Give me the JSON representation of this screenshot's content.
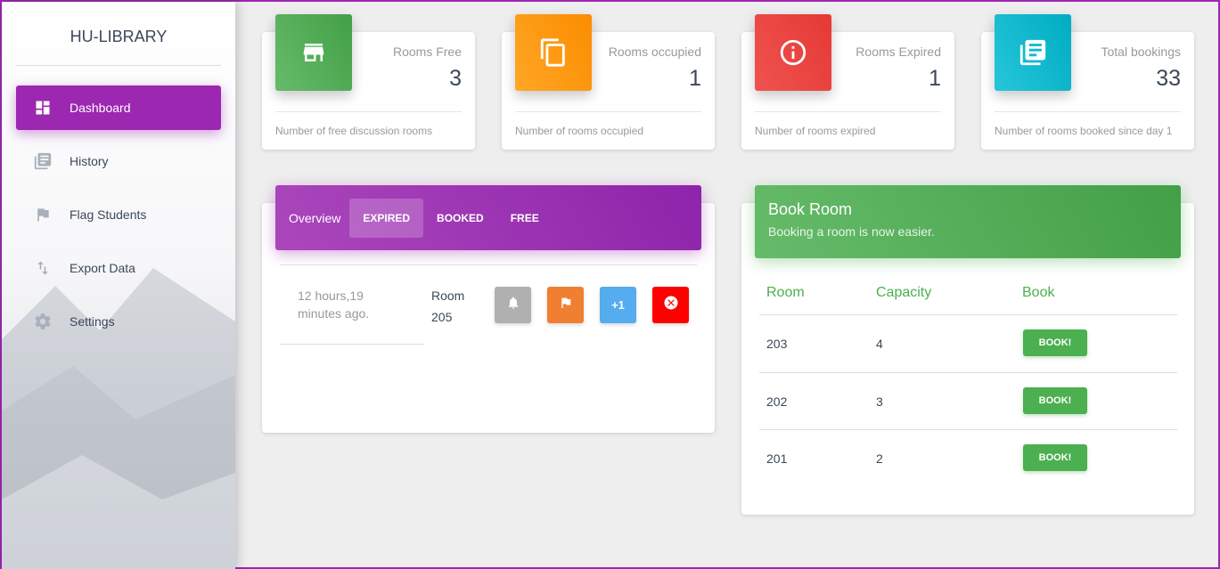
{
  "sidebar": {
    "brand": "HU-LIBRARY",
    "items": [
      {
        "label": "Dashboard",
        "icon": "dashboard-icon",
        "active": true
      },
      {
        "label": "History",
        "icon": "library-books-icon"
      },
      {
        "label": "Flag Students",
        "icon": "flag-icon"
      },
      {
        "label": "Export Data",
        "icon": "import-export-icon"
      },
      {
        "label": "Settings",
        "icon": "gear-icon"
      }
    ]
  },
  "stats": [
    {
      "title": "Rooms Free",
      "value": "3",
      "footer": "Number of free discussion rooms",
      "icon": "store-icon",
      "color": "#4caf50"
    },
    {
      "title": "Rooms occupied",
      "value": "1",
      "footer": "Number of rooms occupied",
      "icon": "content-copy-icon",
      "color": "#ff9800"
    },
    {
      "title": "Rooms Expired",
      "value": "1",
      "footer": "Number of rooms expired",
      "icon": "info-icon",
      "color": "#f44336"
    },
    {
      "title": "Total bookings",
      "value": "33",
      "footer": "Number of rooms booked since day 1",
      "icon": "library-books-icon",
      "color": "#00bcd4"
    }
  ],
  "overview": {
    "label": "Overview",
    "tabs": [
      {
        "label": "EXPIRED",
        "active": true
      },
      {
        "label": "BOOKED"
      },
      {
        "label": "FREE"
      }
    ],
    "entry": {
      "time": "12 hours,19 minutes ago.",
      "room": "Room 205",
      "actions": [
        {
          "icon": "bell-icon",
          "color": "#b0b0b0"
        },
        {
          "icon": "flag-icon",
          "color": "#f07f32"
        },
        {
          "label": "+1",
          "color": "#55acee"
        },
        {
          "icon": "close-circle-icon",
          "color": "#ff0000"
        }
      ]
    }
  },
  "book_room": {
    "title": "Book Room",
    "subtitle": "Booking a room is now easier.",
    "headers": [
      "Room",
      "Capacity",
      "Book"
    ],
    "rows": [
      {
        "room": "203",
        "capacity": "4",
        "button": "BOOK!"
      },
      {
        "room": "202",
        "capacity": "3",
        "button": "BOOK!"
      },
      {
        "room": "201",
        "capacity": "2",
        "button": "BOOK!"
      }
    ]
  },
  "colors": {
    "accent": "#9c27b0",
    "success": "#4caf50",
    "warning": "#ff9800",
    "danger": "#f44336",
    "info": "#00bcd4"
  }
}
